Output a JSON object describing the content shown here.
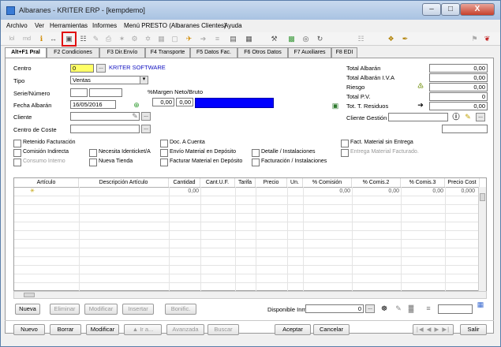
{
  "window": {
    "title": "Albaranes - KRITER ERP -  [kempdemo]",
    "min_glyph": "–",
    "max_glyph": "□",
    "close_glyph": "X"
  },
  "menu": [
    "Archivo",
    "Ver",
    "Herramientas",
    "Informes",
    "Menú PRESTO (Albaranes Clientes)",
    "Ayuda"
  ],
  "toolbar": {
    "items": [
      "lol",
      "rnd",
      "ℹ",
      "↔",
      "▣",
      "☷",
      "✎",
      "⎙",
      "✶",
      "⚙",
      "✡",
      "▦",
      "▢",
      "✈",
      "➔",
      "≡",
      "▤",
      "▦",
      "⚒",
      "▩",
      "◎",
      "↻",
      "☷",
      "❖",
      "✒",
      "⚑",
      "❦"
    ]
  },
  "tabs": [
    "Alt+F1 Pral",
    "F2 Condiciones",
    "F3 Dir.Envío",
    "F4 Transporte",
    "F5 Datos Fac.",
    "F6 Otros Datos",
    "F7 Auxiliares",
    "F8 EDI"
  ],
  "form": {
    "centro_label": "Centro",
    "centro_value": "0",
    "centro_name": "KRITER SOFTWARE",
    "tipo_label": "Tipo",
    "tipo_value": "Ventas",
    "serie_label": "Serie/Número",
    "margen_label": "%Margen Neto/Bruto",
    "margen_neto": "0,00",
    "margen_bruto": "0,00",
    "fecha_label": "Fecha Albarán",
    "fecha_value": "16/05/2016",
    "cliente_label": "Cliente",
    "centro_coste_label": "Centro de Coste",
    "ellipsis": "...",
    "tipo_arrow": "▾"
  },
  "totals": [
    {
      "label": "Total Albarán",
      "value": "0,00"
    },
    {
      "label": "Total Albarán I.V.A",
      "value": "0,00"
    },
    {
      "label": "Riesgo",
      "value": "0,00"
    },
    {
      "label": "Total P.V.",
      "value": "0"
    },
    {
      "label": "Tot. T. Residuos",
      "value": "0,00"
    }
  ],
  "cliente_gestion_label": "Cliente Gestión",
  "checkboxes": [
    {
      "label": "Retenido Facturación",
      "disabled": false
    },
    {
      "label": "Comisión Indirecta",
      "disabled": false
    },
    {
      "label": "Consumo Interno",
      "disabled": true
    },
    {
      "label": "Necesita Identicket/A",
      "disabled": false
    },
    {
      "label": "Nueva Tienda",
      "disabled": false
    },
    {
      "label": "Doc. A Cuenta",
      "disabled": false
    },
    {
      "label": "Envío Material en Depósito",
      "disabled": false
    },
    {
      "label": "Facturar Material en Depósito",
      "disabled": false
    },
    {
      "label": "Detalle / Instalaciones",
      "disabled": false
    },
    {
      "label": "Facturación / Instalaciones",
      "disabled": false
    },
    {
      "label": "Fact. Material sin Entrega",
      "disabled": false
    },
    {
      "label": "Entrega Material Facturado.",
      "disabled": true
    }
  ],
  "grid": {
    "columns": [
      "Artículo",
      "Descripción Artículo",
      "Cantidad",
      "Cant.U.F.",
      "Tarifa",
      "Precio",
      "Un.",
      "% Comisión",
      "% Comis.2",
      "% Comis.3",
      "Precio Cost"
    ],
    "row_marker": "✳",
    "first_row": {
      "cantidad": "0,00",
      "comision": "0,00",
      "comis2": "0,00",
      "comis3": "0,00",
      "precio_cost": "0,000"
    }
  },
  "line_buttons": [
    "Nueva",
    "Eliminar",
    "Modificar",
    "Insertar",
    "Bonific."
  ],
  "disponible_label": "Disponible Inm",
  "disponible_value": "0",
  "bottom_buttons": [
    "Nuevo",
    "Borrar",
    "Modificar",
    "▲ Ir a...",
    "Avanzada",
    "Buscar",
    "Aceptar",
    "Cancelar",
    "Salir"
  ],
  "nav_glyphs": "|◀ ◀ ▶ ▶|"
}
